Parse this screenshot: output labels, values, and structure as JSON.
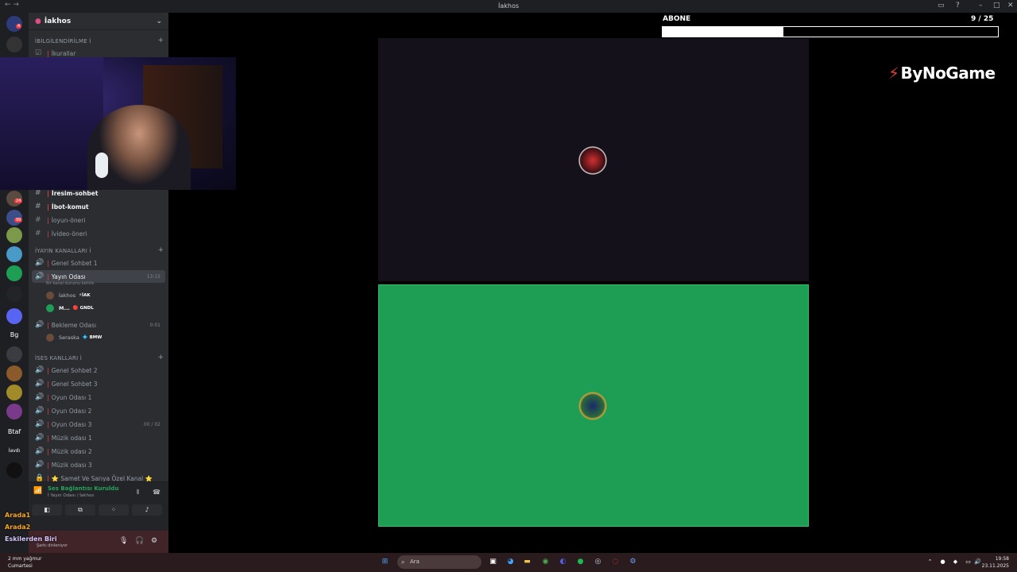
{
  "window": {
    "title": "İakhos",
    "nav": "← →"
  },
  "server": {
    "name": "İakhos",
    "chevron": "⌄"
  },
  "categories": {
    "info": "İBİLGİLENDİRİLME İ",
    "yayin": "İYAYIN KANALLARI İ",
    "ses": "İSES KANLLARI İ"
  },
  "text_channels": [
    {
      "name": "İkurallar"
    },
    {
      "name": "İresim-sohbet"
    },
    {
      "name": "İbot-komut"
    },
    {
      "name": "İoyun-öneri"
    },
    {
      "name": "İvideo-öneri"
    }
  ],
  "voice_channels_top": [
    {
      "name": "Genel Sohbet 1"
    },
    {
      "name": "Yayın Odası",
      "time": "13:15",
      "sub": "Bir kanal durumu belirle"
    },
    {
      "name": "Bekleme Odası",
      "time": "0:01"
    }
  ],
  "members": {
    "yayin": [
      {
        "name": "İakhos",
        "tag": "⚡İAK"
      },
      {
        "name": "M...",
        "tag": "🔴 GNDL"
      }
    ],
    "bekleme": [
      {
        "name": "Seraska",
        "tag": "💠 BMW"
      }
    ]
  },
  "voice_channels_ses": [
    {
      "name": "Genel Sohbet 2"
    },
    {
      "name": "Genel Sohbet 3"
    },
    {
      "name": "Oyun Odası 1"
    },
    {
      "name": "Oyun Odası 2"
    },
    {
      "name": "Oyun Odası 3",
      "time": "00 / 02"
    },
    {
      "name": "Müzik odası 1"
    },
    {
      "name": "Müzik odası 2"
    },
    {
      "name": "Müzik odası 3"
    },
    {
      "name": "⭐ Samet Ve Sarıya Özel Kanal ⭐"
    }
  ],
  "voice_panel": {
    "status": "Ses Bağlantısı Kuruldu",
    "where": "İ Yayın Odası / İakhos"
  },
  "overlay_names": [
    {
      "name": "Arada1",
      "color": "#f5a623"
    },
    {
      "name": "Arada2",
      "color": "#f5a623"
    },
    {
      "name": "Eskilerden Biri",
      "color": "#d6c8ff"
    }
  ],
  "user_panel": {
    "status": "Şarkı dinleniyor"
  },
  "stream": {
    "abone_label": "ABONE",
    "abone_count": "9  / 25",
    "abone_progress": 0.36,
    "logo": "ByNoGame"
  },
  "taskbar": {
    "weather_temp": "2 mm yağmur",
    "weather_day": "Cumartesi",
    "search": "Ara",
    "time": "19:58",
    "date": "23.11.2025"
  },
  "guild_labels": [
    "Bg",
    "Btaf",
    "İavdı"
  ],
  "guild_badges": [
    "4",
    "24",
    "99"
  ],
  "colors": {
    "accent_green": "#1e9e54",
    "danger": "#f23f43",
    "panel_bg": "#2b2d31"
  }
}
